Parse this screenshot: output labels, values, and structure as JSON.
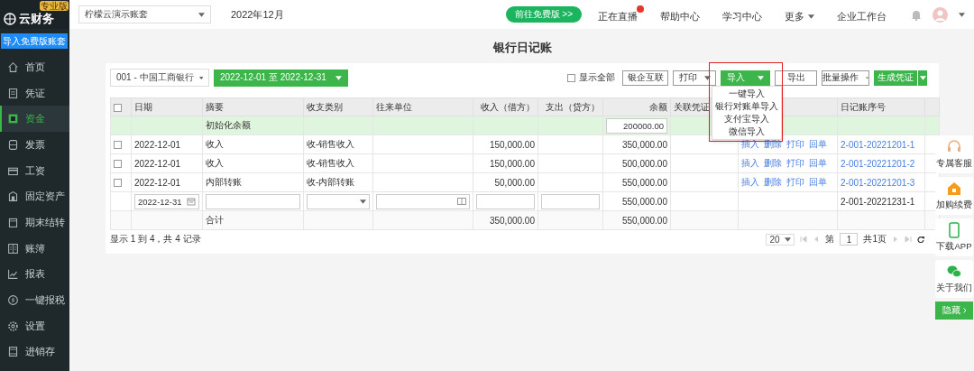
{
  "topbar": {
    "logo": "云财务",
    "edition": "专业版",
    "account": "柠檬云演示账套",
    "period": "2022年12月",
    "free_button": "前往免费版 >>",
    "nav": [
      {
        "label": "正在直播",
        "badge": true,
        "caret": false
      },
      {
        "label": "帮助中心",
        "badge": false,
        "caret": false
      },
      {
        "label": "学习中心",
        "badge": false,
        "caret": false
      },
      {
        "label": "更多",
        "badge": false,
        "caret": true
      },
      {
        "label": "企业工作台",
        "badge": false,
        "caret": false
      }
    ]
  },
  "sidebar": {
    "import_button": "导入免费版账套",
    "items": [
      {
        "label": "首页",
        "selected": false
      },
      {
        "label": "凭证",
        "selected": false
      },
      {
        "label": "资金",
        "selected": true
      },
      {
        "label": "发票",
        "selected": false
      },
      {
        "label": "工资",
        "selected": false
      },
      {
        "label": "固定资产",
        "selected": false
      },
      {
        "label": "期末结转",
        "selected": false
      },
      {
        "label": "账簿",
        "selected": false
      },
      {
        "label": "报表",
        "selected": false
      },
      {
        "label": "一键报税",
        "selected": false
      },
      {
        "label": "设置",
        "selected": false
      },
      {
        "label": "进销存",
        "selected": false
      }
    ]
  },
  "page_title": "银行日记账",
  "toolbar": {
    "bank_account": "001 - 中国工商银行",
    "date_range": "2022-12-01 至 2022-12-31",
    "show_all": {
      "label": "显示全部",
      "checked": false
    },
    "buttons": [
      {
        "label": "银企互联",
        "kind": "plain"
      },
      {
        "label": "打印",
        "kind": "dropdown"
      },
      {
        "label": "导入",
        "kind": "primary-dropdown",
        "expanded": true
      },
      {
        "label": "导出",
        "kind": "plain"
      },
      {
        "label": "批量操作",
        "kind": "dropdown"
      },
      {
        "label": "生成凭证",
        "kind": "primary-split"
      }
    ]
  },
  "import_menu": [
    "一键导入",
    "银行对账单导入",
    "支付宝导入",
    "微信导入"
  ],
  "table": {
    "all_checked": false,
    "columns": [
      "日期",
      "摘要",
      "收支类别",
      "往来单位",
      "收入（借方）",
      "支出（贷方）",
      "余额",
      "关联凭证",
      null,
      "日记账序号"
    ],
    "rows": [
      {
        "kind": "opening",
        "summary": "初始化余额",
        "balance": "200000.00"
      },
      {
        "kind": "data",
        "checked": false,
        "date": "2022-12-01",
        "summary": "收入",
        "category": "收-销售收入",
        "income": "150,000.00",
        "balance": "350,000.00",
        "actions": [
          "插入",
          "删除",
          "打印",
          "回单"
        ],
        "serial": "2-001-20221201-1"
      },
      {
        "kind": "data",
        "checked": false,
        "date": "2022-12-01",
        "summary": "收入",
        "category": "收-销售收入",
        "income": "150,000.00",
        "balance": "500,000.00",
        "actions": [
          "插入",
          "删除",
          "打印",
          "回单"
        ],
        "serial": "2-001-20221201-2"
      },
      {
        "kind": "data",
        "checked": false,
        "date": "2022-12-01",
        "summary": "内部转账",
        "category": "收-内部转账",
        "income": "50,000.00",
        "balance": "550,000.00",
        "actions": [
          "插入",
          "删除",
          "打印",
          "回单"
        ],
        "serial": "2-001-20221201-3"
      },
      {
        "kind": "entry",
        "date": "2022-12-31",
        "balance": "550,000.00",
        "serial": "2-001-20221231-1"
      },
      {
        "kind": "total",
        "summary": "合计",
        "income": "350,000.00",
        "balance": "550,000.00"
      }
    ]
  },
  "footer": {
    "summary": "显示 1 到 4，共 4 记录",
    "page_size": "20",
    "page_prefix": "第",
    "page": "1",
    "page_total": "共1页"
  },
  "float_panel": {
    "items": [
      "专属客服",
      "加购续费",
      "下载APP",
      "关于我们"
    ],
    "hide_button": "隐藏"
  }
}
